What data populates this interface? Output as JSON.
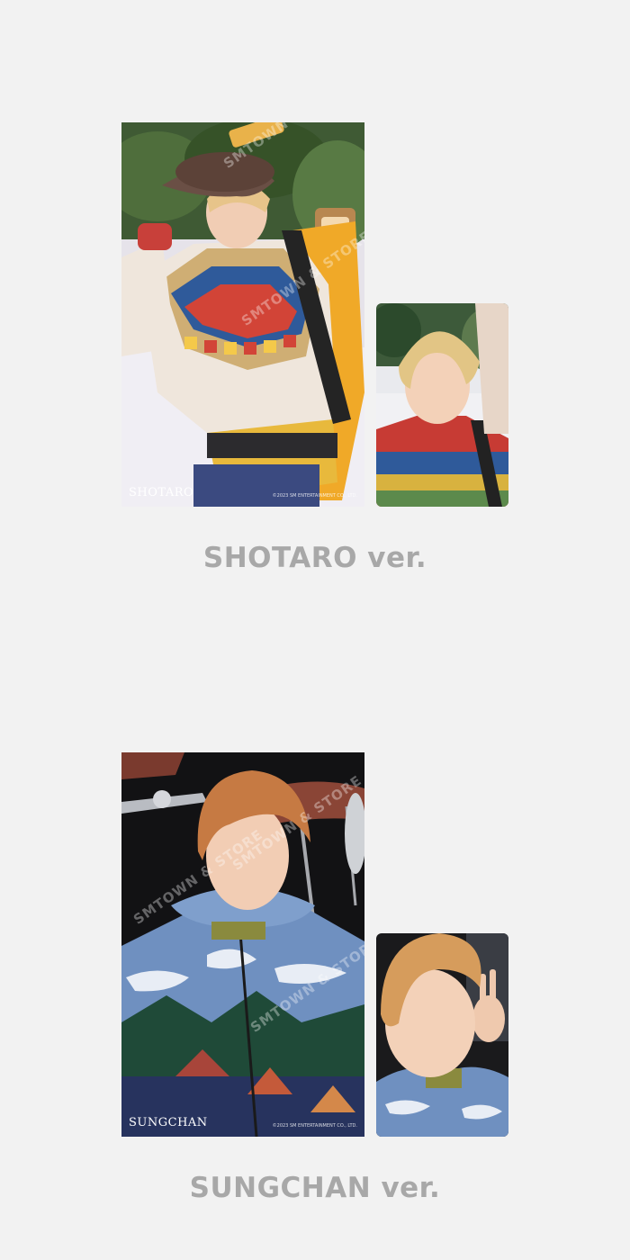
{
  "items": [
    {
      "caption": "SHOTARO ver.",
      "poster_name": "SHOTARO",
      "poster_credit": "©2023 SM ENTERTAINMENT CO., LTD.",
      "watermark": "SMTOWN & STORE"
    },
    {
      "caption": "SUNGCHAN ver.",
      "poster_name": "SUNGCHAN",
      "poster_credit": "©2023 SM ENTERTAINMENT CO., LTD.",
      "watermark": "SMTOWN & STORE"
    }
  ],
  "colors": {
    "background": "#f2f2f2",
    "caption": "#a8a8a8"
  }
}
